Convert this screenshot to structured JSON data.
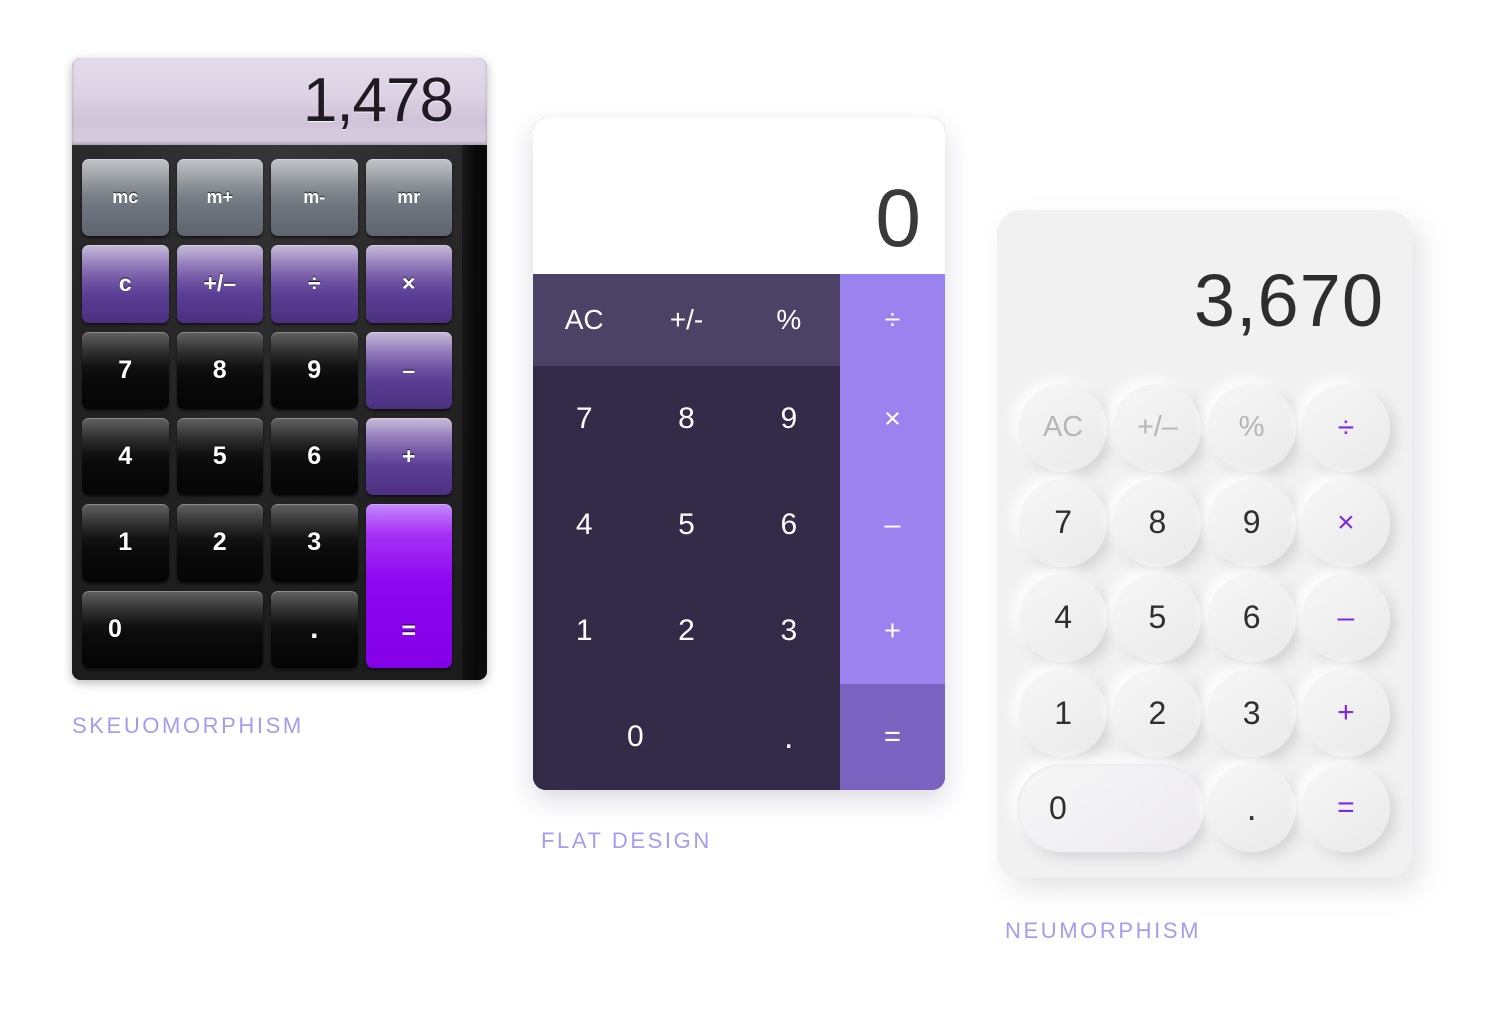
{
  "page": {
    "background_color": "#ffffff",
    "caption_color": "#a79bf0"
  },
  "calculators": [
    {
      "id": "skeuomorphism",
      "caption": "SKEUOMORPHISM",
      "display_value": "1,478",
      "accent_color": "#8800ee",
      "rows": {
        "memory": [
          "mc",
          "m+",
          "m-",
          "mr"
        ],
        "operators_top": [
          "c",
          "+/–",
          "÷",
          "×"
        ],
        "r7": [
          "7",
          "8",
          "9",
          "–"
        ],
        "r4": [
          "4",
          "5",
          "6",
          "+"
        ],
        "r1": [
          "1",
          "2",
          "3"
        ],
        "r0": [
          "0",
          "."
        ],
        "equals": "="
      }
    },
    {
      "id": "flat-design",
      "caption": "FLAT DESIGN",
      "display_value": "0",
      "accent_color": "#9a82ef",
      "rows": {
        "functions": [
          "AC",
          "+/-",
          "%"
        ],
        "r7": [
          "7",
          "8",
          "9"
        ],
        "r4": [
          "4",
          "5",
          "6"
        ],
        "r1": [
          "1",
          "2",
          "3"
        ],
        "r0": [
          "0",
          "."
        ],
        "operators": [
          "÷",
          "×",
          "–",
          "+",
          "="
        ]
      }
    },
    {
      "id": "neumorphism",
      "caption": "NEUMORPHISM",
      "display_value": "3,670",
      "accent_color": "#7c2ae8",
      "rows": {
        "functions": [
          "AC",
          "+/–",
          "%"
        ],
        "r7": [
          "7",
          "8",
          "9"
        ],
        "r4": [
          "4",
          "5",
          "6"
        ],
        "r1": [
          "1",
          "2",
          "3"
        ],
        "r0": [
          "0",
          "."
        ],
        "operators": [
          "÷",
          "×",
          "–",
          "+",
          "="
        ]
      }
    }
  ]
}
